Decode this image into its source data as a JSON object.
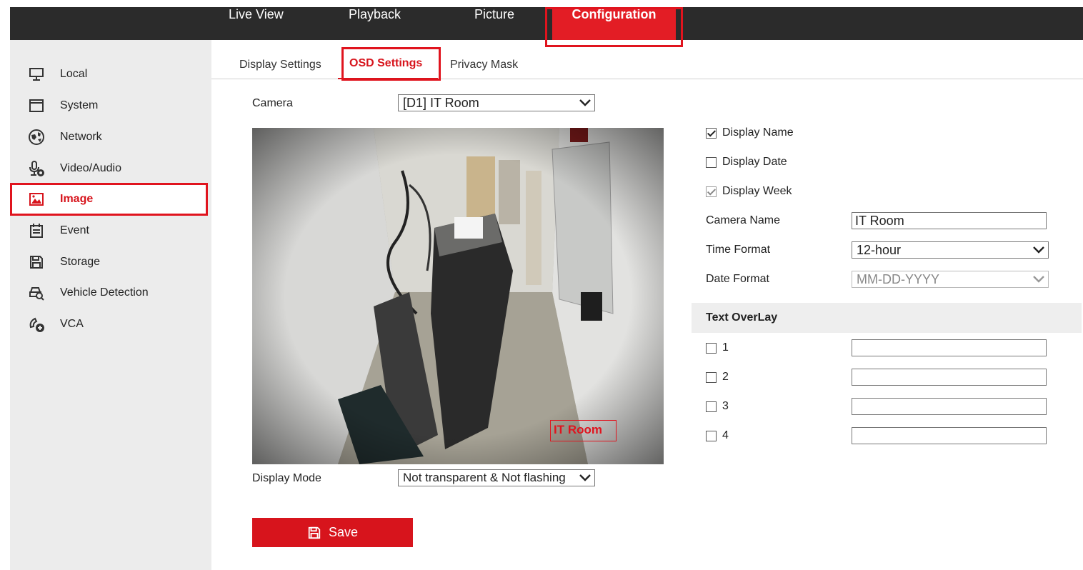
{
  "topnav": {
    "items": [
      "Live View",
      "Playback",
      "Picture",
      "Configuration"
    ],
    "active": "Configuration"
  },
  "sidebar": {
    "items": [
      {
        "label": "Local",
        "icon": "monitor-icon"
      },
      {
        "label": "System",
        "icon": "window-icon"
      },
      {
        "label": "Network",
        "icon": "globe-icon"
      },
      {
        "label": "Video/Audio",
        "icon": "microphone-icon"
      },
      {
        "label": "Image",
        "icon": "image-icon"
      },
      {
        "label": "Event",
        "icon": "calendar-icon"
      },
      {
        "label": "Storage",
        "icon": "floppy-icon"
      },
      {
        "label": "Vehicle Detection",
        "icon": "vehicle-search-icon"
      },
      {
        "label": "VCA",
        "icon": "vca-icon"
      }
    ],
    "active": "Image"
  },
  "subtabs": {
    "items": [
      "Display Settings",
      "OSD Settings",
      "Privacy Mask"
    ],
    "active": "OSD Settings"
  },
  "form": {
    "camera_label": "Camera",
    "camera_value": "[D1] IT Room",
    "display_mode_label": "Display Mode",
    "display_mode_value": "Not transparent & Not flashing",
    "osd_overlay_text": "IT Room",
    "display_name": {
      "label": "Display Name",
      "checked": true
    },
    "display_date": {
      "label": "Display Date",
      "checked": false
    },
    "display_week": {
      "label": "Display Week",
      "checked": true,
      "disabled": true
    },
    "camera_name_label": "Camera Name",
    "camera_name_value": "IT Room",
    "time_format_label": "Time Format",
    "time_format_value": "12-hour",
    "date_format_label": "Date Format",
    "date_format_value": "MM-DD-YYYY",
    "text_overlay_header": "Text OverLay",
    "overlays": [
      {
        "label": "1",
        "checked": false,
        "value": ""
      },
      {
        "label": "2",
        "checked": false,
        "value": ""
      },
      {
        "label": "3",
        "checked": false,
        "value": ""
      },
      {
        "label": "4",
        "checked": false,
        "value": ""
      }
    ],
    "save_label": "Save"
  },
  "colors": {
    "accent": "#d7141c",
    "topbar": "#2b2b2b",
    "sidebar": "#ececec"
  }
}
